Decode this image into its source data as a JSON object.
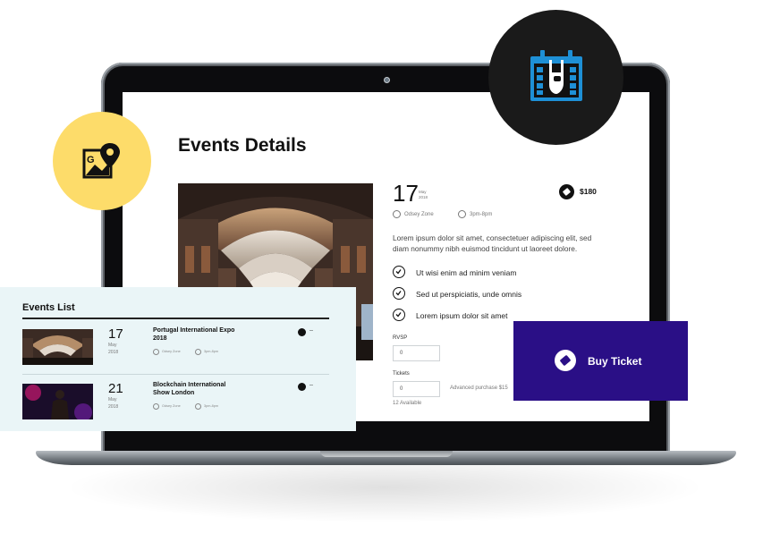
{
  "details": {
    "title": "Events Details",
    "day": "17",
    "month": "May",
    "year": "2018",
    "price": "$180",
    "location": "Odsey Zone",
    "time": "3pm-8pm",
    "description": "Lorem ipsum dolor sit amet, consectetuer adipiscing elit, sed diam nonummy nibh euismod tincidunt ut laoreet dolore.",
    "checklist": [
      "Ut wisi enim ad minim veniam",
      "Sed ut perspiciatis, unde omnis",
      "Lorem ipsum dolor sit amet"
    ],
    "rsvp_label": "RVSP",
    "rsvp_value": "0",
    "tickets_label": "Tickets",
    "tickets_value": "0",
    "advanced_purchase": "Advanced purchase $15",
    "available": "12 Available"
  },
  "buy_ticket": {
    "label": "Buy Ticket"
  },
  "events_list": {
    "title": "Events List",
    "items": [
      {
        "day": "17",
        "month": "May",
        "year": "2018",
        "title": "Portugal International Expo 2018",
        "location": "Odsey Zone",
        "time": "3pm-8pm",
        "price": "--"
      },
      {
        "day": "21",
        "month": "May",
        "year": "2018",
        "title": "Blockchain International Show London",
        "location": "Odsey Zone",
        "time": "3pm-8pm",
        "price": "--"
      }
    ]
  },
  "icons": {
    "map": "map-pin-icon",
    "calendar": "rock-calendar-icon",
    "ticket": "ticket-icon",
    "location": "location-icon",
    "time": "clock-icon",
    "check": "check-circle-icon"
  },
  "colors": {
    "yellow_badge": "#fddc6a",
    "buy_button": "#2a0f86",
    "calendar_blue": "#1e90d6",
    "list_card_bg": "#eaf5f7"
  }
}
